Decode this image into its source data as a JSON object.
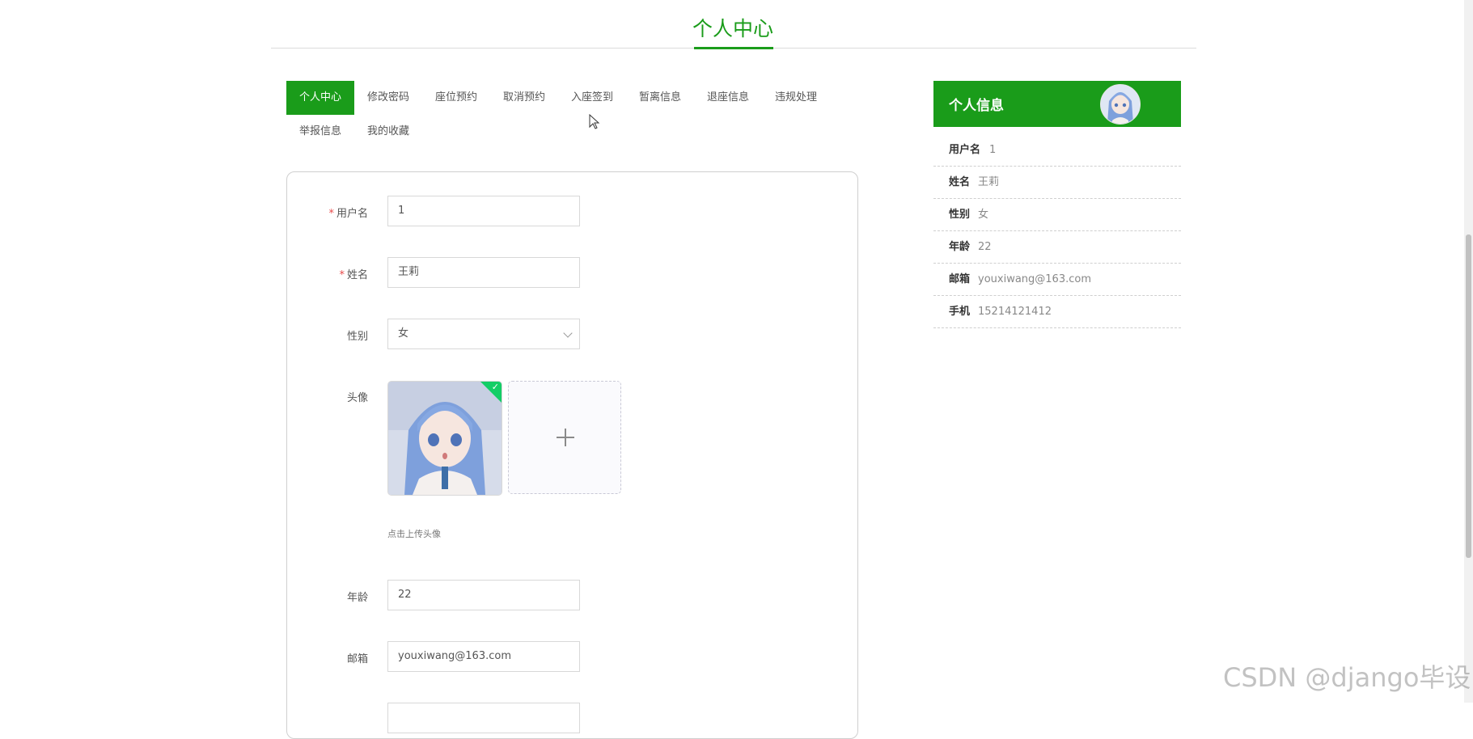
{
  "page": {
    "title": "个人中心"
  },
  "tabs": [
    {
      "label": "个人中心",
      "active": true
    },
    {
      "label": "修改密码"
    },
    {
      "label": "座位预约"
    },
    {
      "label": "取消预约"
    },
    {
      "label": "入座签到"
    },
    {
      "label": "暂离信息"
    },
    {
      "label": "退座信息"
    },
    {
      "label": "违规处理"
    },
    {
      "label": "举报信息"
    },
    {
      "label": "我的收藏"
    }
  ],
  "form": {
    "username": {
      "label": "用户名",
      "value": "1",
      "required": true
    },
    "name": {
      "label": "姓名",
      "value": "王莉",
      "required": true
    },
    "gender": {
      "label": "性别",
      "value": "女"
    },
    "avatar": {
      "label": "头像",
      "hint": "点击上传头像"
    },
    "age": {
      "label": "年龄",
      "value": "22"
    },
    "email": {
      "label": "邮箱",
      "value": "youxiwang@163.com"
    }
  },
  "info_panel": {
    "title": "个人信息",
    "rows": [
      {
        "key": "用户名",
        "value": "1"
      },
      {
        "key": "姓名",
        "value": "王莉"
      },
      {
        "key": "性别",
        "value": "女"
      },
      {
        "key": "年龄",
        "value": "22"
      },
      {
        "key": "邮箱",
        "value": "youxiwang@163.com"
      },
      {
        "key": "手机",
        "value": "15214121412"
      }
    ]
  },
  "watermark": "CSDN @django毕设",
  "colors": {
    "accent": "#1a9c1a",
    "success": "#13ce66",
    "required": "#e84a4a"
  }
}
